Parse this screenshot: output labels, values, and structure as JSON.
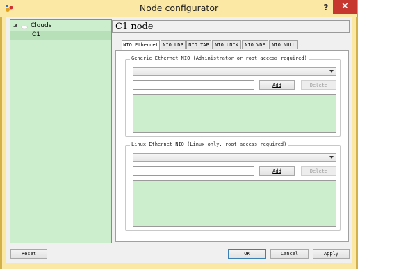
{
  "window": {
    "title": "Node configurator",
    "help_label": "?",
    "close_label": "✕",
    "colors": {
      "frame": "#fbe8a4",
      "close": "#c7372f",
      "green": "#cdeecd"
    }
  },
  "tree": {
    "group": "Clouds",
    "toggle": "◢",
    "item": "C1"
  },
  "header": {
    "title": "C1 node"
  },
  "tabs": [
    {
      "label": "NIO Ethernet"
    },
    {
      "label": "NIO UDP"
    },
    {
      "label": "NIO TAP"
    },
    {
      "label": "NIO UNIX"
    },
    {
      "label": "NIO VDE"
    },
    {
      "label": "NIO NULL"
    }
  ],
  "generic": {
    "title": "Generic Ethernet NIO (Administrator or root access required)",
    "combo_value": "",
    "input_value": "",
    "add_label": "Add",
    "delete_label": "Delete"
  },
  "linux": {
    "title": "Linux Ethernet NIO (Linux only, root access required)",
    "combo_value": "",
    "input_value": "",
    "add_label": "Add",
    "delete_label": "Delete"
  },
  "footer": {
    "reset_label": "Reset",
    "ok_label": "OK",
    "cancel_label": "Cancel",
    "apply_label": "Apply"
  }
}
